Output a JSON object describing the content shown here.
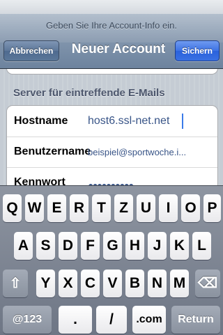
{
  "prompt": "Geben Sie Ihre Account-Info ein.",
  "nav": {
    "title": "Neuer Account",
    "cancel_label": "Abbrechen",
    "save_label": "Sichern"
  },
  "section": {
    "header": "Server für eintreffende E-Mails",
    "rows": [
      {
        "label": "Hostname",
        "value": "host6.ssl-net.net"
      },
      {
        "label": "Benutzername",
        "value": "beispiel@sportwoche.i..."
      },
      {
        "label": "Kennwort",
        "value": "●●●●●●●●●●"
      }
    ]
  },
  "keyboard": {
    "row1": [
      "Q",
      "W",
      "E",
      "R",
      "T",
      "Z",
      "U",
      "I",
      "O",
      "P"
    ],
    "row2": [
      "A",
      "S",
      "D",
      "F",
      "G",
      "H",
      "J",
      "K",
      "L"
    ],
    "row3": [
      "Y",
      "X",
      "C",
      "V",
      "B",
      "N",
      "M"
    ],
    "shift": "⇧",
    "delete": "⌫",
    "numbers": "@123",
    "dot": ".",
    "slash": "/",
    "dotcom": ".com",
    "return": "Return"
  }
}
